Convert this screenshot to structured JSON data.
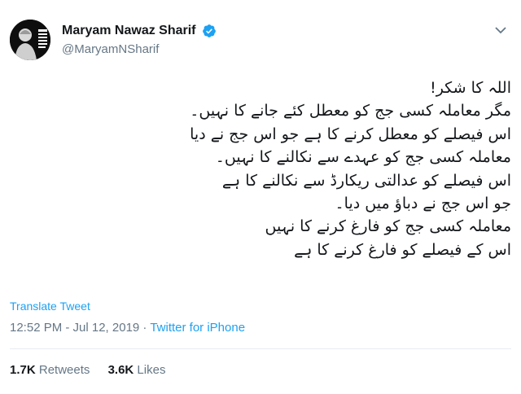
{
  "author": {
    "display_name": "Maryam Nawaz Sharif",
    "handle": "@MaryamNSharif",
    "avatar_text": "FREE NAWAZ SHARIF"
  },
  "tweet": {
    "lines": [
      "اللہ کا شکر!",
      "مگر معاملہ کسی جج کو معطل کئے جانے کا نہیں۔",
      "اس فیصلے کو معطل کرنے کا ہے جو اس جج نے دیا",
      "معاملہ کسی جج کو عہدے سے نکالنے کا نہیں۔",
      "اس فیصلے کو عدالتی ریکارڈ سے نکالنے کا ہے",
      "جو اس جج نے دباؤ میں دیا۔",
      "معاملہ کسی جج کو فارغ کرنے کا نہیں",
      "اس کے فیصلے کو فارغ کرنے کا ہے"
    ],
    "translate_label": "Translate Tweet",
    "timestamp": "12:52 PM - Jul 12, 2019",
    "separator": " · ",
    "source": "Twitter for iPhone"
  },
  "stats": {
    "retweets_count": "1.7K",
    "retweets_label": "Retweets",
    "likes_count": "3.6K",
    "likes_label": "Likes"
  },
  "colors": {
    "accent": "#1da1f2",
    "muted": "#657786",
    "text": "#14171a"
  },
  "icons": {
    "verified": "verified-badge-icon",
    "menu": "chevron-down-icon"
  }
}
